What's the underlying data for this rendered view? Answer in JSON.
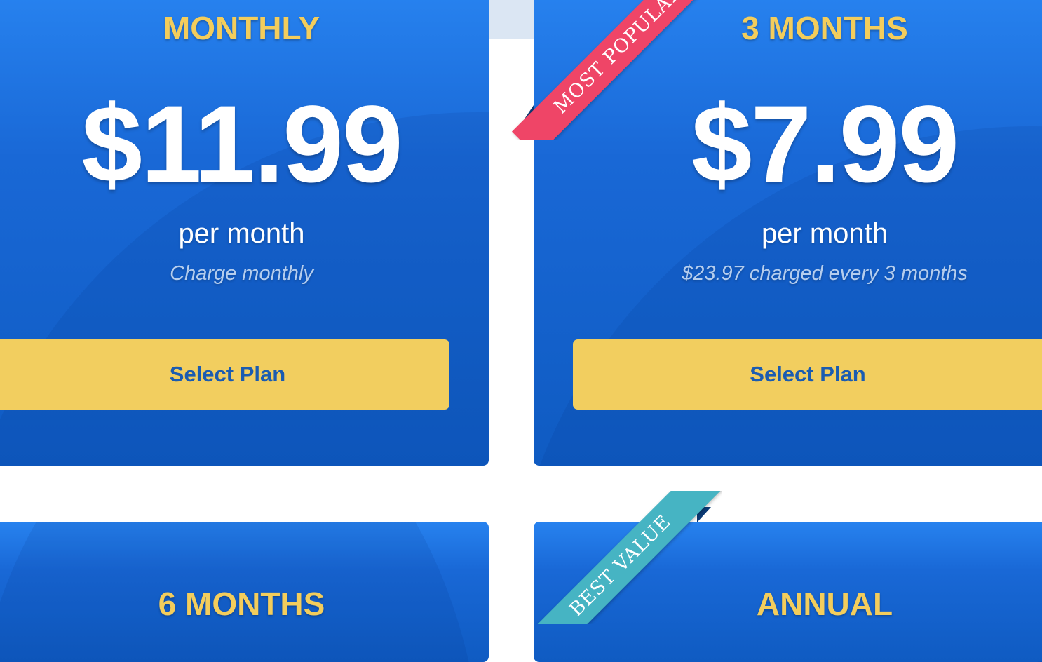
{
  "plans": [
    {
      "id": "monthly",
      "title": "MONTHLY",
      "price": "$11.99",
      "period": "per month",
      "note": "Charge monthly",
      "button": "Select Plan"
    },
    {
      "id": "3-months",
      "title": "3 MONTHS",
      "price": "$7.99",
      "period": "per month",
      "note": "$23.97 charged every 3 months",
      "button": "Select Plan",
      "ribbon": "MOST POPULAR"
    },
    {
      "id": "6-months",
      "title": "6 MONTHS"
    },
    {
      "id": "annual",
      "title": "ANNUAL",
      "ribbon": "BEST VALUE"
    }
  ],
  "colors": {
    "card_blue": "#1968d6",
    "title_gold": "#f3cd5c",
    "button_gold": "#f2ce5f",
    "button_text": "#1b5cb1",
    "ribbon_popular": "#ef4567",
    "ribbon_value": "#46b4c3"
  }
}
